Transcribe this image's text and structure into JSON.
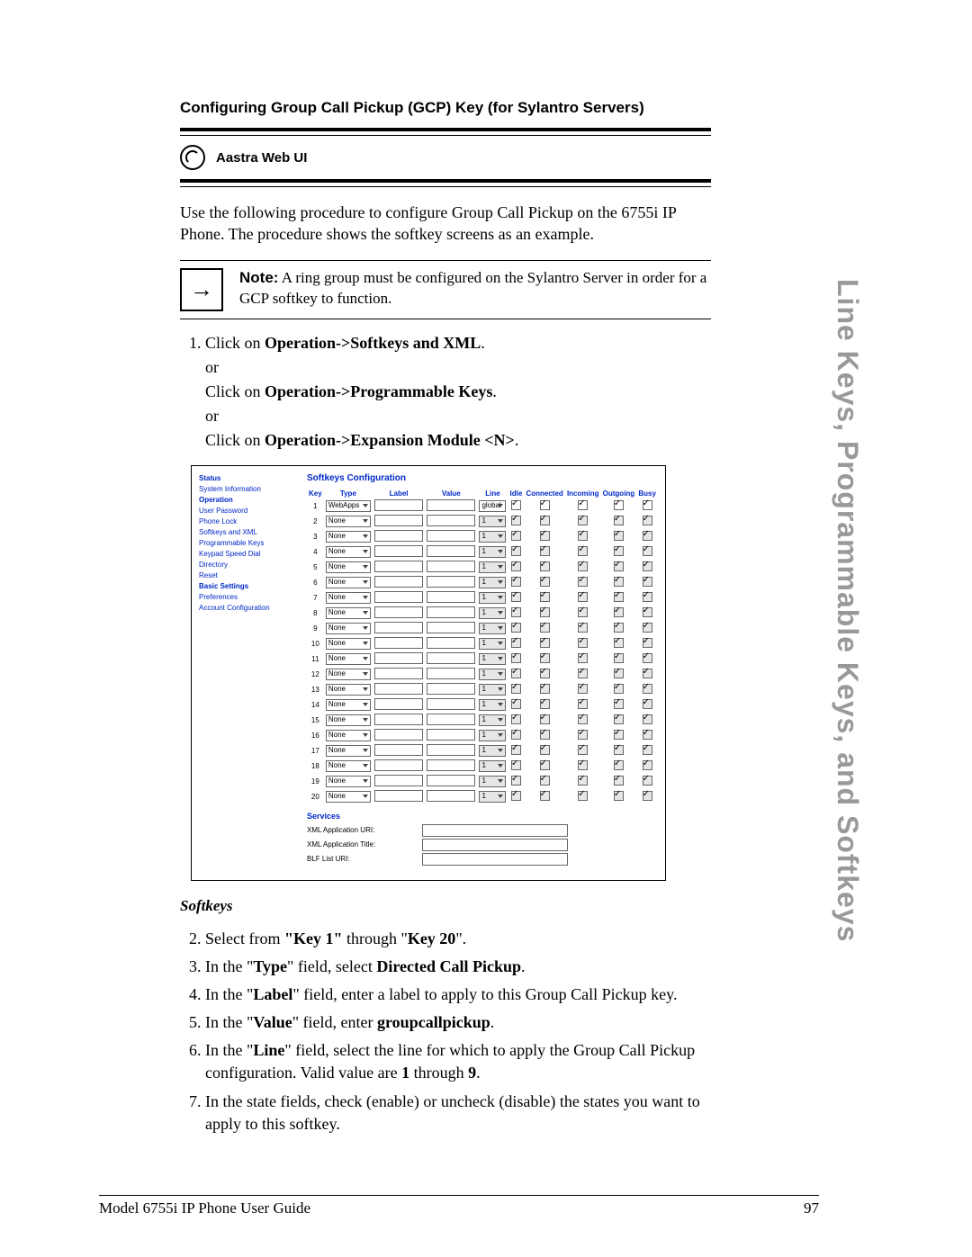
{
  "heading": "Configuring Group Call Pickup (GCP) Key (for Sylantro Servers)",
  "aastra_label": "Aastra Web UI",
  "intro": "Use the following procedure to configure Group Call Pickup on the 6755i IP Phone. The procedure shows the softkey screens as an example.",
  "note_label": "Note:",
  "note_text": " A ring group must be configured on the Sylantro Server in order for a GCP softkey to function.",
  "step1_a": "Click on ",
  "step1_b": "Operation->Softkeys and XML",
  "step1_c": ".",
  "step1_or": "or",
  "step1_d": "Click on ",
  "step1_e": "Operation->Programmable Keys",
  "step1_f": "Click on ",
  "step1_g": "Operation->Expansion Module <N>",
  "shot": {
    "nav": {
      "status": "Status",
      "sysinfo": "System Information",
      "operation": "Operation",
      "items": [
        "User Password",
        "Phone Lock",
        "Softkeys and XML",
        "Programmable Keys",
        "Keypad Speed Dial",
        "Directory",
        "Reset"
      ],
      "basic": "Basic Settings",
      "basic_items": [
        "Preferences",
        "Account Configuration"
      ]
    },
    "title": "Softkeys Configuration",
    "headers": [
      "Key",
      "Type",
      "Label",
      "Value",
      "Line",
      "Idle",
      "Connected",
      "Incoming",
      "Outgoing",
      "Busy"
    ],
    "rows": [
      {
        "n": "1",
        "type": "WebApps",
        "line": "global",
        "gray": false
      },
      {
        "n": "2",
        "type": "None",
        "line": "1",
        "gray": true
      },
      {
        "n": "3",
        "type": "None",
        "line": "1",
        "gray": true
      },
      {
        "n": "4",
        "type": "None",
        "line": "1",
        "gray": true
      },
      {
        "n": "5",
        "type": "None",
        "line": "1",
        "gray": true
      },
      {
        "n": "6",
        "type": "None",
        "line": "1",
        "gray": true
      },
      {
        "n": "7",
        "type": "None",
        "line": "1",
        "gray": true
      },
      {
        "n": "8",
        "type": "None",
        "line": "1",
        "gray": true
      },
      {
        "n": "9",
        "type": "None",
        "line": "1",
        "gray": true
      },
      {
        "n": "10",
        "type": "None",
        "line": "1",
        "gray": true
      },
      {
        "n": "11",
        "type": "None",
        "line": "1",
        "gray": true
      },
      {
        "n": "12",
        "type": "None",
        "line": "1",
        "gray": true
      },
      {
        "n": "13",
        "type": "None",
        "line": "1",
        "gray": true
      },
      {
        "n": "14",
        "type": "None",
        "line": "1",
        "gray": true
      },
      {
        "n": "15",
        "type": "None",
        "line": "1",
        "gray": true
      },
      {
        "n": "16",
        "type": "None",
        "line": "1",
        "gray": true
      },
      {
        "n": "17",
        "type": "None",
        "line": "1",
        "gray": true
      },
      {
        "n": "18",
        "type": "None",
        "line": "1",
        "gray": true
      },
      {
        "n": "19",
        "type": "None",
        "line": "1",
        "gray": true
      },
      {
        "n": "20",
        "type": "None",
        "line": "1",
        "gray": true
      }
    ],
    "services": "Services",
    "srv1": "XML Application URI:",
    "srv2": "XML Application Title:",
    "srv3": "BLF List URI:"
  },
  "softkeys_head": "Softkeys",
  "s2a": "Select from ",
  "s2b": "\"Key 1\"",
  "s2c": " through \"",
  "s2d": "Key 20",
  "s2e": "\".",
  "s3a": "In the \"",
  "s3b": "Type",
  "s3c": "\" field, select ",
  "s3d": "Directed Call Pickup",
  "s3e": ".",
  "s4a": "In the \"",
  "s4b": "Label",
  "s4c": "\" field, enter a label to apply to this Group Call Pickup key.",
  "s5a": "In the \"",
  "s5b": "Value",
  "s5c": "\" field, enter ",
  "s5d": "groupcallpickup",
  "s5e": ".",
  "s6a": "In the \"",
  "s6b": "Line",
  "s6c": "\" field, select the line for which to apply the Group Call Pickup configuration. Valid value are ",
  "s6d": "1",
  "s6e": " through ",
  "s6f": "9",
  "s6g": ".",
  "s7": "In the state fields, check (enable) or uncheck (disable) the states you want to apply to this softkey.",
  "side_title": "Line Keys, Programmable Keys, and Softkeys",
  "footer_left": "Model 6755i IP Phone User Guide",
  "footer_right": "97"
}
